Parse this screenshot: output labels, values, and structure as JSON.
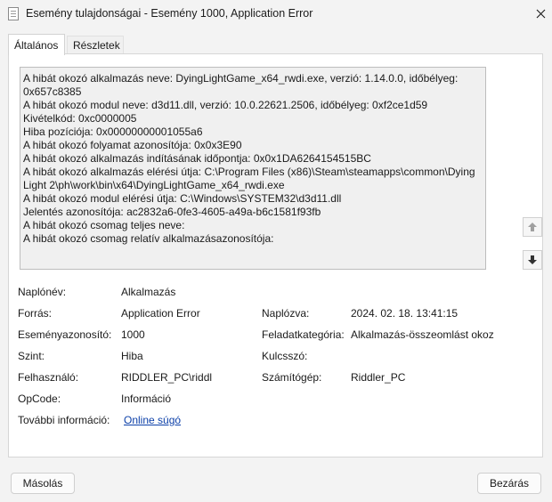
{
  "window": {
    "title": "Esemény tulajdonságai - Esemény 1000, Application Error",
    "icon": "event-properties-icon",
    "close_icon": "close-icon"
  },
  "tabs": [
    {
      "label": "Általános",
      "active": true
    },
    {
      "label": "Részletek",
      "active": false
    }
  ],
  "description": {
    "lines": [
      "A hibát okozó alkalmazás neve: DyingLightGame_x64_rwdi.exe, verzió: 1.14.0.0, időbélyeg:",
      "0x657c8385",
      "A hibát okozó modul neve: d3d11.dll, verzió: 10.0.22621.2506, időbélyeg: 0xf2ce1d59",
      "Kivételkód: 0xc0000005",
      "Hiba pozíciója: 0x00000000001055a6",
      "A hibát okozó folyamat azonosítója: 0x0x3E90",
      "A hibát okozó alkalmazás indításának időpontja: 0x0x1DA6264154515BC",
      "A hibát okozó alkalmazás elérési útja: C:\\Program Files (x86)\\Steam\\steamapps\\common\\Dying",
      "Light 2\\ph\\work\\bin\\x64\\DyingLightGame_x64_rwdi.exe",
      "A hibát okozó modul elérési útja: C:\\Windows\\SYSTEM32\\d3d11.dll",
      "Jelentés azonosítója: ac2832a6-0fe3-4605-a49a-b6c1581f93fb",
      "A hibát okozó csomag teljes neve:",
      "A hibát okozó csomag relatív alkalmazásazonosítója:"
    ]
  },
  "nav": {
    "up_icon": "arrow-up-icon",
    "down_icon": "arrow-down-icon"
  },
  "fields": {
    "log_name": {
      "label": "Naplónév:",
      "value": "Alkalmazás"
    },
    "source": {
      "label": "Forrás:",
      "value": "Application Error"
    },
    "logged": {
      "label": "Naplózva:",
      "value": "2024. 02. 18. 13:41:15"
    },
    "event_id": {
      "label": "Eseményazonosító:",
      "value": "1000"
    },
    "task_category": {
      "label": "Feladatkategória:",
      "value": "Alkalmazás-összeomlást okoz"
    },
    "level": {
      "label": "Szint:",
      "value": "Hiba"
    },
    "keywords": {
      "label": "Kulcsszó:",
      "value": ""
    },
    "user": {
      "label": "Felhasználó:",
      "value": "RIDDLER_PC\\riddl"
    },
    "computer": {
      "label": "Számítógép:",
      "value": "Riddler_PC"
    },
    "opcode": {
      "label": "OpCode:",
      "value": "Információ"
    },
    "more_info": {
      "label": "További információ:",
      "value": "Online súgó"
    }
  },
  "buttons": {
    "copy": "Másolás",
    "close": "Bezárás"
  },
  "colors": {
    "link": "#0b3fa8",
    "background": "#f3f3f3",
    "panel": "#ffffff"
  }
}
